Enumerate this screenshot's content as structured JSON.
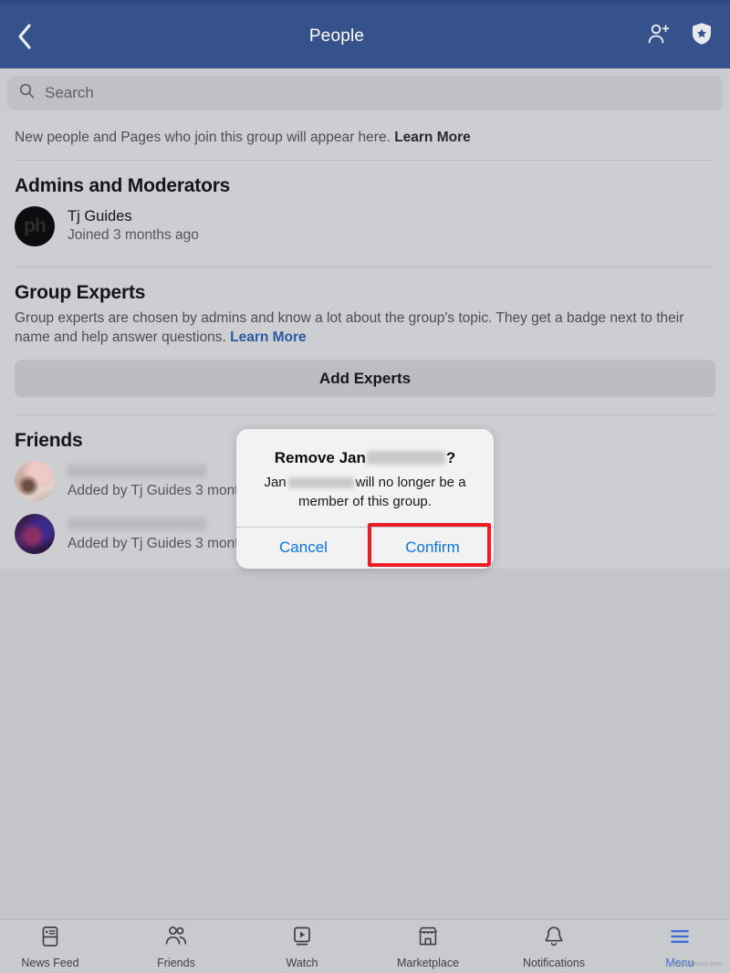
{
  "header": {
    "title": "People",
    "back_icon": "chevron-left-icon",
    "add_person_icon": "add-person-icon",
    "shield_star_icon": "shield-star-icon"
  },
  "search": {
    "placeholder": "Search",
    "icon": "search-icon"
  },
  "banner": {
    "text": "New people and Pages who join this group will appear here. ",
    "link": "Learn More"
  },
  "admins": {
    "section_title": "Admins and Moderators",
    "members": [
      {
        "name": "Tj Guides",
        "sub": "Joined 3 months ago",
        "avatar": "tj-guides-avatar"
      }
    ]
  },
  "experts": {
    "section_title": "Group Experts",
    "description": "Group experts are chosen by admins and know a lot about the group's topic. They get a badge next to their name and help answer questions. ",
    "link": "Learn More",
    "button_label": "Add Experts"
  },
  "friends": {
    "section_title": "Friends",
    "members": [
      {
        "name": "",
        "name_redacted": true,
        "sub": "Added by Tj Guides 3 months",
        "avatar": "friend-photo-avatar-1"
      },
      {
        "name": "",
        "name_redacted": true,
        "sub": "Added by Tj Guides 3 months",
        "avatar": "friend-photo-avatar-2"
      }
    ]
  },
  "dialog": {
    "title_prefix": "Remove Jan",
    "title_suffix": "?",
    "message_prefix": "Jan",
    "message_mid": "will no longer be a",
    "message_line2": "member of this group.",
    "cancel_label": "Cancel",
    "confirm_label": "Confirm",
    "highlight_color": "#ee1c25"
  },
  "bottom_nav": {
    "items": [
      {
        "label": "News Feed",
        "icon": "news-feed-icon",
        "active": false
      },
      {
        "label": "Friends",
        "icon": "friends-icon",
        "active": false
      },
      {
        "label": "Watch",
        "icon": "watch-icon",
        "active": false
      },
      {
        "label": "Marketplace",
        "icon": "marketplace-icon",
        "active": false
      },
      {
        "label": "Notifications",
        "icon": "notifications-icon",
        "active": false
      },
      {
        "label": "Menu",
        "icon": "menu-icon",
        "active": true
      }
    ],
    "active_color": "#3b6fd4"
  },
  "watermark": "www.tiexuu.com"
}
